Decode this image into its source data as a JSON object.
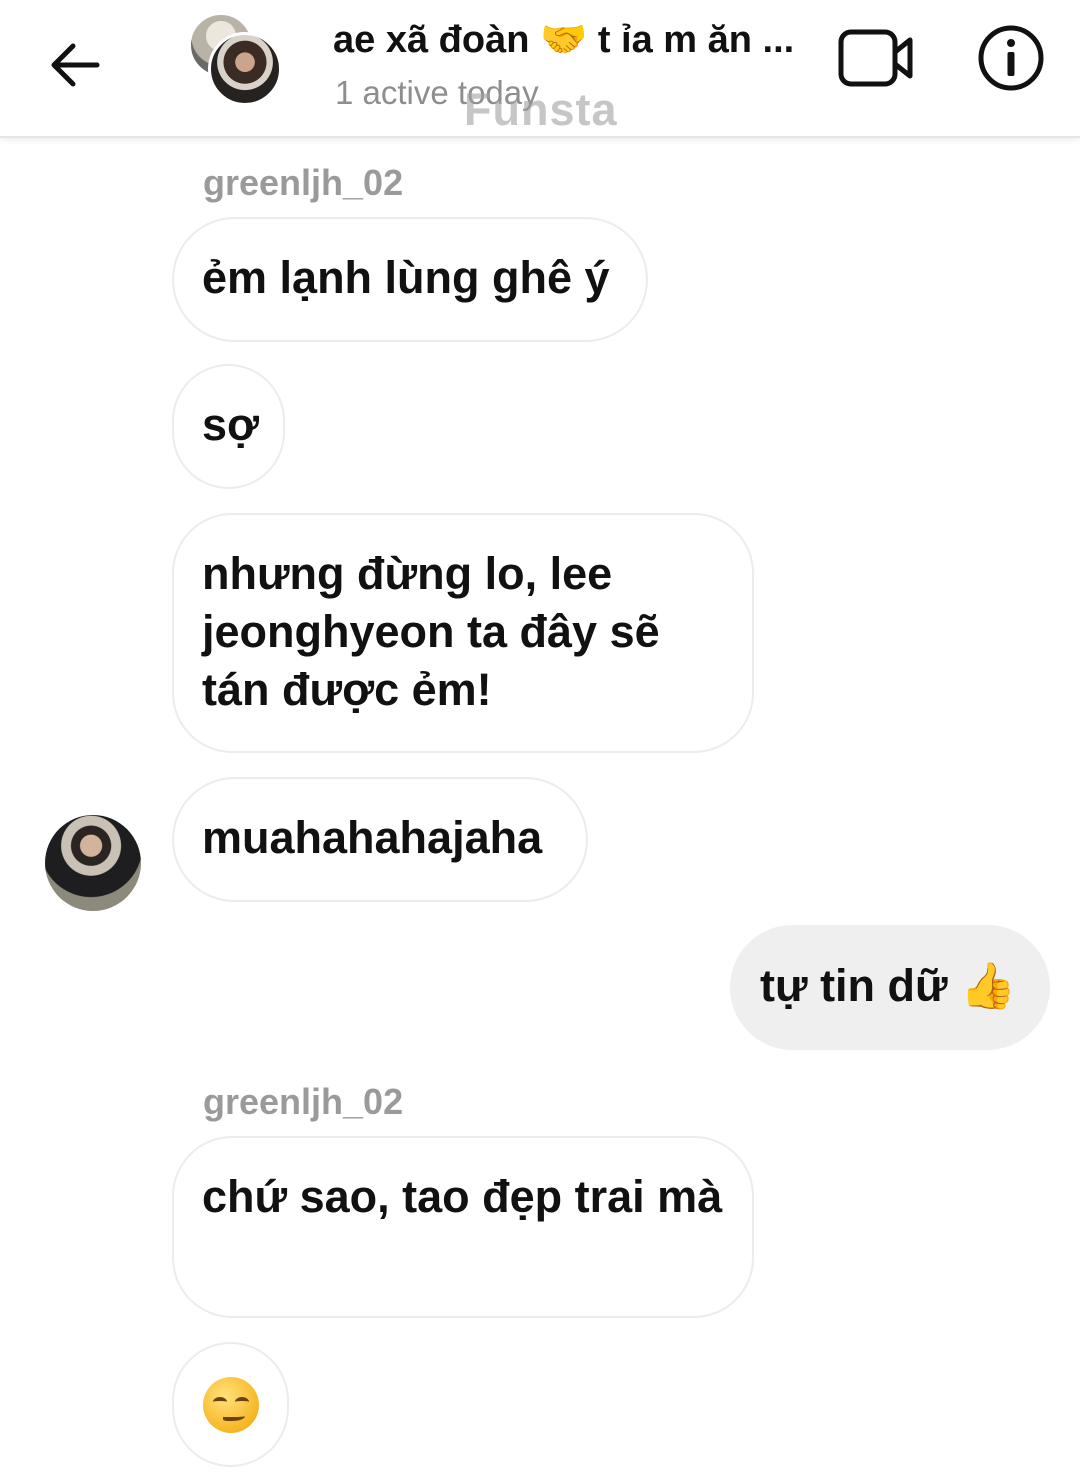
{
  "header": {
    "title": "ae xã đoàn 🤝 t ỉa m ăn ...",
    "status": "1 active today",
    "watermark": "Funsta",
    "icons": [
      "back-arrow-icon",
      "video-call-icon",
      "info-icon"
    ]
  },
  "messages": [
    {
      "sender": "greenljh_02"
    },
    {
      "text": "ẻm lạnh lùng ghê ý"
    },
    {
      "text": "sợ"
    },
    {
      "text": "nhưng đừng lo, lee jeonghyeon ta đây sẽ tán được ẻm!"
    },
    {
      "text": "muahahahajaha"
    },
    {
      "text": "tự tin dữ 👍"
    },
    {
      "sender": "greenljh_02"
    },
    {
      "text": "chứ sao, tao đẹp trai mà"
    },
    {
      "emoji": "smirking-face-emoji"
    }
  ],
  "colors": {
    "outgoing_bubble": "#efefef",
    "incoming_border": "#ececec",
    "sender_name": "#9a9a9a",
    "status_text": "#8e8e8e"
  }
}
